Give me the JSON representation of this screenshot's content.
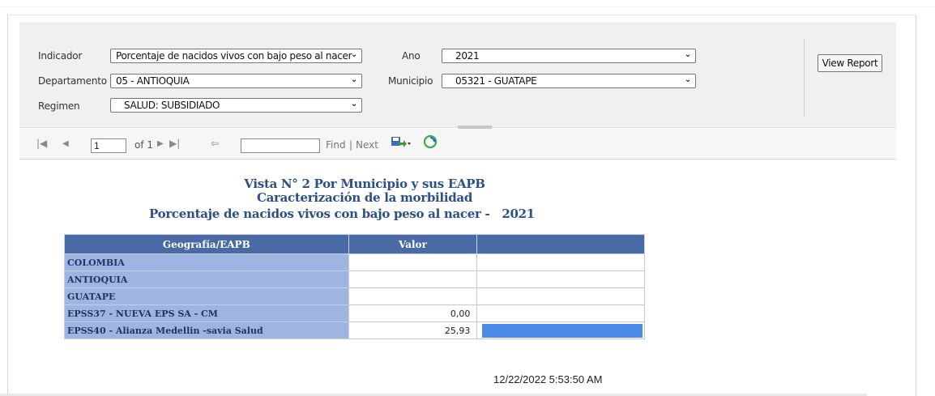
{
  "parameters": {
    "indicador": {
      "label": "Indicador",
      "value": "Porcentaje de nacidos vivos con bajo peso al nacer"
    },
    "departamento": {
      "label": "Departamento",
      "value": "05 - ANTIOQUIA"
    },
    "regimen": {
      "label": "Regimen",
      "value": "SALUD: SUBSIDIADO"
    },
    "ano": {
      "label": "Ano",
      "value": "2021"
    },
    "municipio": {
      "label": "Municipio",
      "value": "05321 - GUATAPE"
    },
    "view_report_label": "View Report"
  },
  "toolbar": {
    "page_value": "1",
    "page_of": "of 1",
    "find_label": "Find",
    "separator": "|",
    "next_label": "Next"
  },
  "report": {
    "title_line1": "Vista N° 2 Por Municipio y sus EAPB",
    "title_line2": "Caracterización de la morbilidad",
    "title_line3": "Porcentaje de nacidos vivos con bajo peso al nacer -",
    "title_year": "2021",
    "columns": [
      "Geografía/EAPB",
      "Valor",
      ""
    ],
    "rows": [
      {
        "geo": "COLOMBIA",
        "value": "",
        "bar_fraction": 0
      },
      {
        "geo": "ANTIOQUIA",
        "value": "",
        "bar_fraction": 0
      },
      {
        "geo": "GUATAPE",
        "value": "",
        "bar_fraction": 0
      },
      {
        "geo": "EPSS37 - NUEVA EPS SA - CM",
        "value": "0,00",
        "bar_fraction": 0
      },
      {
        "geo": "EPSS40 - Alianza Medellin -savia Salud",
        "value": "25,93",
        "bar_fraction": 1
      }
    ],
    "timestamp": "12/22/2022 5:53:50 AM",
    "bar_color": "#4a8ae8",
    "header_color": "#4a6aa5",
    "geo_cell_color": "#9db5e0"
  }
}
